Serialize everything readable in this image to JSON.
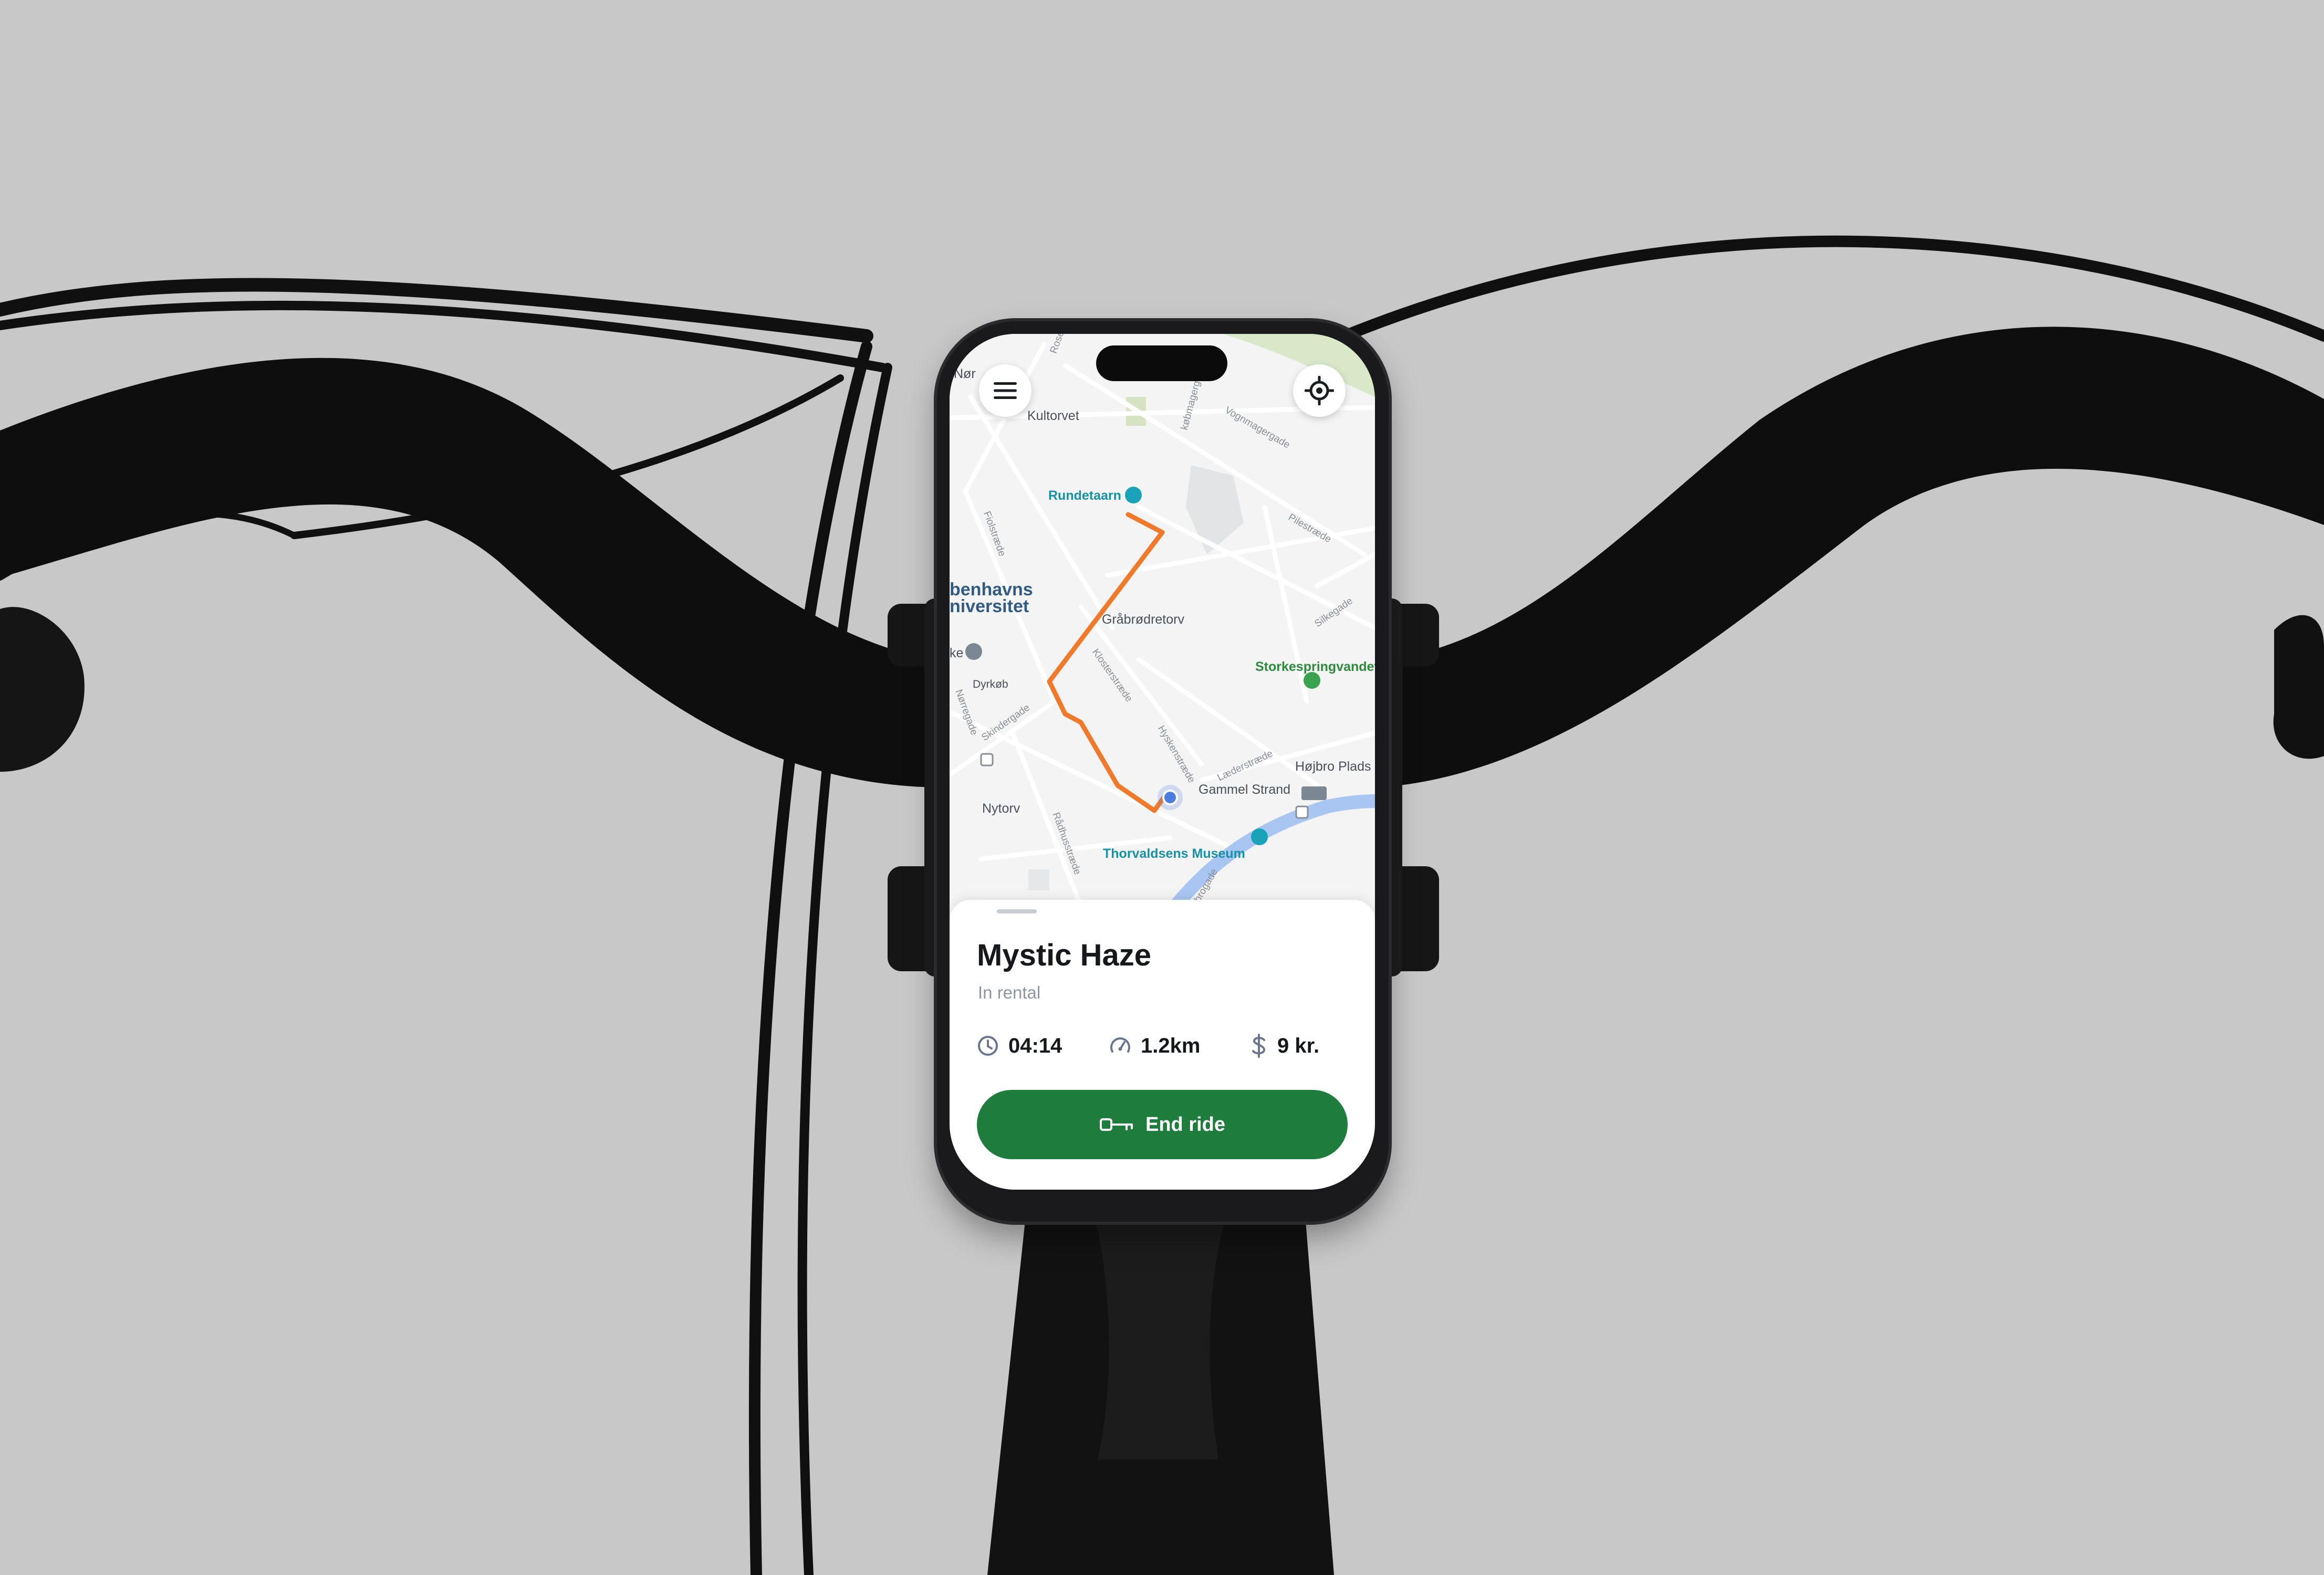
{
  "map": {
    "labels": {
      "kultorvet": "Kultorvet",
      "rundetaarn": "Rundetaarn",
      "university_line1": "benhavns",
      "university_line2": "niversitet",
      "grabrodretorv": "Gråbrødretorv",
      "storkespringvandet": "Storkespringvandet",
      "hojbro_plads": "Højbro Plads",
      "gammel_strand": "Gammel Strand",
      "nytorv": "Nytorv",
      "thorvaldsens_museum": "Thorvaldsens Museum",
      "dyrkob": "Dyrkøb",
      "kultorvet_prefix": "Nør",
      "ke": "ke"
    },
    "streets": {
      "rosengaarden": "Rosen",
      "vognmagergade": "Vognmagergade",
      "pilestraede": "Pilestræde",
      "silkegade": "Silkegade",
      "fiolstraede": "Fiolstræde",
      "klosterstraede": "Klosterstræde",
      "hyskenstraede": "Hyskenstræde",
      "laederstraede": "Læderstræde",
      "norregade": "Nørregade",
      "skindergade": "Skindergade",
      "radhusstraede": "Rådhusstræde",
      "kobmagergade": "købmagergade",
      "brogade": "brogade",
      "kejsergade": "gade"
    },
    "menu_icon": "hamburger-menu-icon",
    "locate_icon": "crosshair-locate-icon",
    "route_color": "#f07a2a",
    "location_dot_color": "#4a7de0",
    "canal_color": "#a9c6f2"
  },
  "ride": {
    "bike_name": "Mystic Haze",
    "status": "In rental",
    "duration": "04:14",
    "distance": "1.2km",
    "price": "9 kr.",
    "duration_icon": "clock-icon",
    "distance_icon": "speedometer-icon",
    "price_icon": "dollar-icon",
    "end_button_label": "End ride",
    "end_button_icon": "key-icon",
    "end_button_color": "#1e7d3c"
  }
}
